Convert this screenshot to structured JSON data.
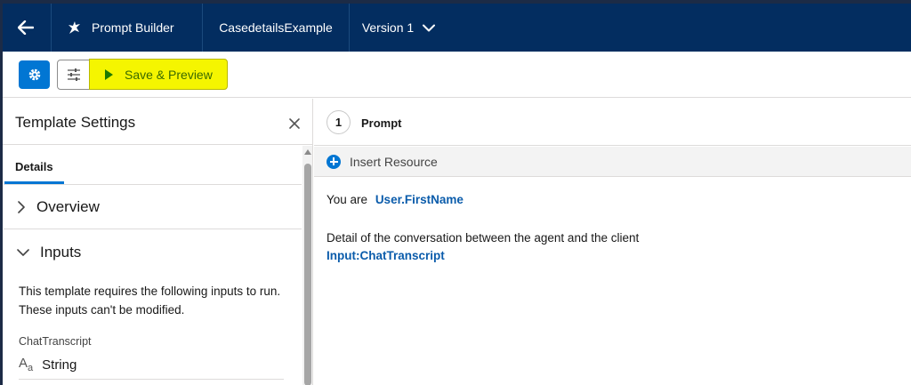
{
  "header": {
    "app_label": "Prompt Builder",
    "template_name": "CasedetailsExample",
    "version_label": "Version 1"
  },
  "toolbar": {
    "save_preview_label": "Save & Preview"
  },
  "left_panel": {
    "title": "Template Settings",
    "tab_label": "Details",
    "sections": {
      "overview": "Overview",
      "inputs": "Inputs"
    },
    "inputs_description": "This template requires the following inputs to run. These inputs can't be modified.",
    "input": {
      "name": "ChatTranscript",
      "type": "String"
    }
  },
  "right_panel": {
    "step_number": "1",
    "step_label": "Prompt",
    "insert_resource_label": "Insert Resource",
    "prompt": {
      "line1_text": "You are",
      "line1_merge": "User.FirstName",
      "line2_text": "Detail of the conversation between the agent and the client",
      "line3_merge": "Input:ChatTranscript"
    }
  },
  "colors": {
    "header_bg": "#032d60",
    "brand_blue": "#0176d3",
    "save_highlight": "#f5f500",
    "merge_field": "#0b5cab"
  },
  "icons": {
    "back": "arrow-left-icon",
    "app": "prompt-builder-icon",
    "version_chevron": "chevron-down-icon",
    "settings": "gear-icon",
    "tune": "sliders-icon",
    "play": "play-icon",
    "close": "close-icon",
    "collapsed": "chevron-right-icon",
    "expanded": "chevron-down-icon",
    "text_type": "text-type-icon",
    "insert": "add-circle-icon"
  }
}
